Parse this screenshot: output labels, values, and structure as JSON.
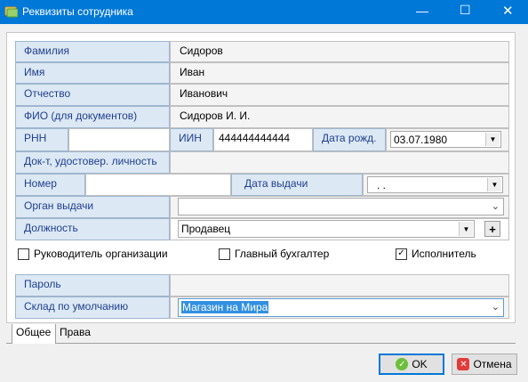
{
  "window": {
    "title": "Реквизиты сотрудника"
  },
  "fields": {
    "last_name": {
      "label": "Фамилия",
      "value": "Сидоров"
    },
    "first_name": {
      "label": "Имя",
      "value": "Иван"
    },
    "patronymic": {
      "label": "Отчество",
      "value": "Иванович"
    },
    "fio_docs": {
      "label": "ФИО (для документов)",
      "value": "Сидоров И. И."
    },
    "rnn": {
      "label": "РНН",
      "value": ""
    },
    "iin": {
      "label": "ИИН",
      "value": "444444444444"
    },
    "birth_date": {
      "label": "Дата рожд.",
      "value": "03.07.1980"
    },
    "id_doc": {
      "label": "Док-т, удостовер. личность"
    },
    "doc_number": {
      "label": "Номер",
      "value": ""
    },
    "issue_date": {
      "label": "Дата выдачи",
      "value": ". ."
    },
    "issuer": {
      "label": "Орган выдачи",
      "value": ""
    },
    "position": {
      "label": "Должность",
      "value": "Продавец"
    },
    "password": {
      "label": "Пароль",
      "value": ""
    },
    "default_warehouse": {
      "label": "Склад по умолчанию",
      "value": "Магазин на Мира"
    }
  },
  "checkboxes": [
    {
      "label": "Руководитель организации",
      "checked": false
    },
    {
      "label": "Главный бухгалтер",
      "checked": false
    },
    {
      "label": "Исполнитель",
      "checked": true
    }
  ],
  "tabs": [
    "Общее",
    "Права"
  ],
  "buttons": {
    "ok": "OK",
    "cancel": "Отмена",
    "add_position": "+"
  },
  "window_controls": {
    "minimize": "—",
    "maximize": "☐",
    "close": "✕"
  },
  "colors": {
    "titlebar": "#0078d7",
    "label_bg": "#dce8f4",
    "label_text": "#1f3f8f"
  }
}
